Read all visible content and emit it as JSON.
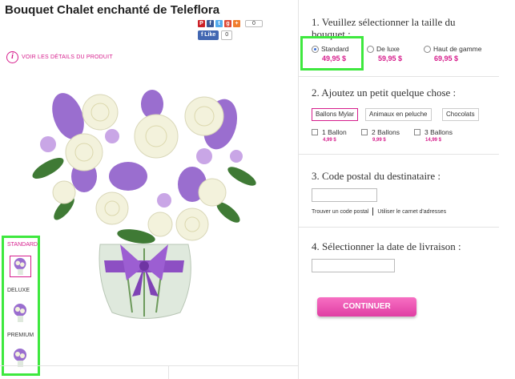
{
  "product": {
    "title": "Bouquet Chalet enchanté de Teleflora",
    "details_link": "VOIR LES DÉTAILS DU PRODUIT"
  },
  "social": {
    "share_count": "0",
    "fb_like_label": "Like",
    "fb_count": "0",
    "icons": [
      "pinterest-icon",
      "facebook-icon",
      "twitter-icon",
      "google-plus-icon",
      "add-icon"
    ]
  },
  "thumbnails": [
    {
      "label": "STANDARD",
      "selected": true
    },
    {
      "label": "DELUXE",
      "selected": false
    },
    {
      "label": "PREMIUM",
      "selected": false
    }
  ],
  "step1": {
    "title_line1": "1. Veuillez sélectionner la taille du",
    "title_line2": "bouquet :",
    "options": [
      {
        "label": "Standard",
        "price": "49,95 $",
        "selected": true
      },
      {
        "label": "De luxe",
        "price": "59,95 $",
        "selected": false
      },
      {
        "label": "Haut de gamme",
        "price": "69,95 $",
        "selected": false
      }
    ]
  },
  "step2": {
    "title": "2. Ajoutez un petit quelque chose :",
    "tabs": [
      {
        "label": "Ballons Mylar",
        "active": true
      },
      {
        "label": "Animaux en peluche",
        "active": false
      },
      {
        "label": "Chocolats",
        "active": false
      }
    ],
    "addons": [
      {
        "label": "1 Ballon",
        "price": "4,99 $"
      },
      {
        "label": "2 Ballons",
        "price": "9,99 $"
      },
      {
        "label": "3 Ballons",
        "price": "14,99 $"
      }
    ]
  },
  "step3": {
    "title": "3. Code postal du destinataire :",
    "postal_value": "",
    "find_code_link": "Trouver un code postal",
    "address_book_link": "Utiliser le carnet d'adresses"
  },
  "step4": {
    "title": "4. Sélectionner la date de livraison :",
    "date_value": ""
  },
  "continue_button": "CONTINUER",
  "colors": {
    "accent": "#d61d8c",
    "highlight": "#3ee83e",
    "button": "#e94fb2"
  }
}
